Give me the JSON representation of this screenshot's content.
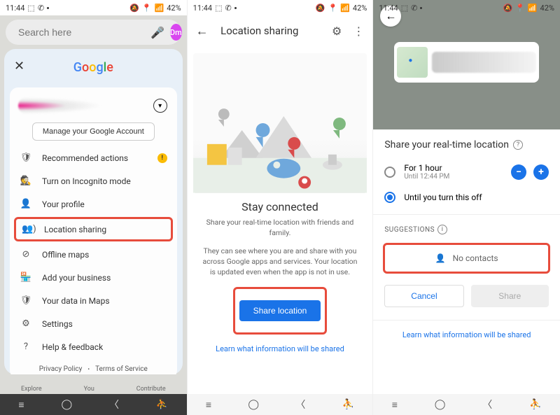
{
  "status": {
    "time": "11:44",
    "battery": "42%",
    "icons": "⬚ ✆ ⚬"
  },
  "s1": {
    "search_placeholder": "Search here",
    "avatar": "Dm",
    "logo": "Google",
    "manage_btn": "Manage your Google Account",
    "menu": {
      "recommended": "Recommended actions",
      "incognito": "Turn on Incognito mode",
      "profile": "Your profile",
      "location_sharing": "Location sharing",
      "offline": "Offline maps",
      "business": "Add your business",
      "yourdata": "Your data in Maps",
      "settings": "Settings",
      "help": "Help & feedback"
    },
    "footer": {
      "privacy": "Privacy Policy",
      "tos": "Terms of Service"
    },
    "tabs": {
      "explore": "Explore",
      "you": "You",
      "contribute": "Contribute"
    }
  },
  "s2": {
    "title": "Location sharing",
    "heading": "Stay connected",
    "p1": "Share your real-time location with friends and family.",
    "p2": "They can see where you are and share with you across Google apps and services. Your location is updated even when the app is not in use.",
    "btn": "Share location",
    "link": "Learn what information will be shared"
  },
  "s3": {
    "title": "Share your real-time location",
    "opt1_label": "For 1 hour",
    "opt1_sub": "Until 12:44 PM",
    "opt2_label": "Until you turn this off",
    "suggestions": "SUGGESTIONS",
    "nocontacts": "No contacts",
    "cancel": "Cancel",
    "share": "Share",
    "link": "Learn what information will be shared"
  }
}
